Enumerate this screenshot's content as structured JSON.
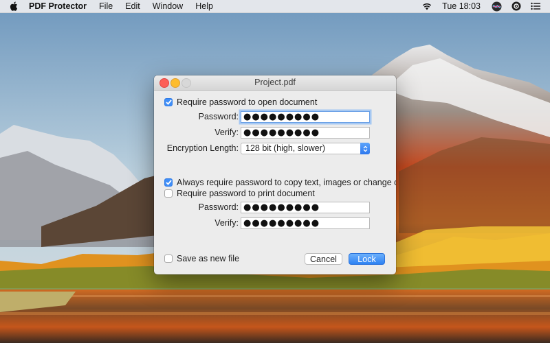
{
  "menubar": {
    "app_name": "PDF Protector",
    "menus": [
      "File",
      "Edit",
      "Window",
      "Help"
    ],
    "clock": "Tue 18:03"
  },
  "window": {
    "title": "Project.pdf",
    "open_section": {
      "require_label": "Require password to open document",
      "require_checked": true,
      "password_label": "Password:",
      "password_value": "●●●●●●●●●",
      "verify_label": "Verify:",
      "verify_value": "●●●●●●●●●",
      "encryption_label": "Encryption Length:",
      "encryption_value": "128 bit (high, slower)"
    },
    "print_section": {
      "always_label": "Always require password to copy text, images or change content.",
      "always_checked": true,
      "require_label": "Require password to print document",
      "require_checked": false,
      "password_label": "Password:",
      "password_value": "●●●●●●●●●",
      "verify_label": "Verify:",
      "verify_value": "●●●●●●●●●"
    },
    "footer": {
      "save_new_label": "Save as new file",
      "save_new_checked": false,
      "cancel_label": "Cancel",
      "lock_label": "Lock"
    }
  },
  "colors": {
    "accent": "#3f8ef7",
    "close": "#fc5f57",
    "minimize": "#fdbc2e"
  }
}
